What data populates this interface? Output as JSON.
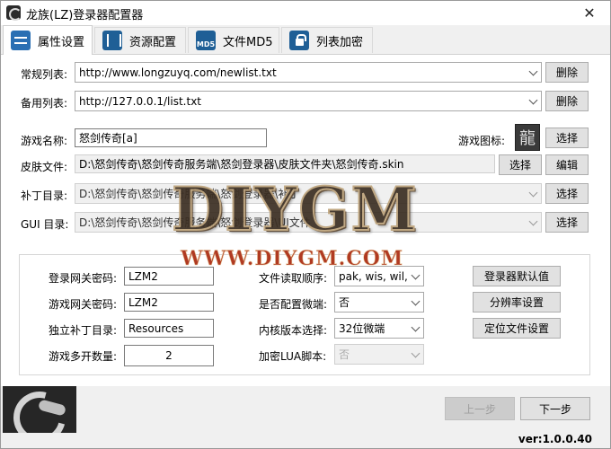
{
  "window": {
    "title": "龙族(LZ)登录器配置器",
    "close_glyph": "✕"
  },
  "tabs": [
    {
      "label": "属性设置",
      "icon": "settings-icon",
      "active": true
    },
    {
      "label": "资源配置",
      "icon": "resource-icon"
    },
    {
      "label": "文件MD5",
      "icon": "md5-icon",
      "icon_text": "MD5"
    },
    {
      "label": "列表加密",
      "icon": "lock-file-icon"
    }
  ],
  "lists": {
    "regular_label": "常规列表:",
    "regular_value": "http://www.longzuyq.com/newlist.txt",
    "backup_label": "备用列表:",
    "backup_value": "http://127.0.0.1/list.txt",
    "delete_label": "删除"
  },
  "game": {
    "name_label": "游戏名称:",
    "name_value": "怒剑传奇[a]",
    "icon_label": "游戏图标:",
    "icon_glyph": "龍",
    "choose_label": "选择"
  },
  "paths": {
    "skin_label": "皮肤文件:",
    "skin_value": "D:\\怒剑传奇\\怒剑传奇服务端\\怒剑登录器\\皮肤文件夹\\怒剑传奇.skin",
    "edit_label": "编辑",
    "patch_label": "补丁目录:",
    "patch_value": "D:\\怒剑传奇\\怒剑传奇服务端\\怒剑登录器\\补丁",
    "gui_label": "GUI 目录:",
    "gui_value": "D:\\怒剑传奇\\怒剑传奇服务端\\怒剑登录器\\UI文件"
  },
  "settings": {
    "login_gw_pwd_label": "登录网关密码:",
    "login_gw_pwd_value": "LZM2",
    "game_gw_pwd_label": "游戏网关密码:",
    "game_gw_pwd_value": "LZM2",
    "patch_dir_label": "独立补丁目录:",
    "patch_dir_value": "Resources",
    "multi_open_label": "游戏多开数量:",
    "multi_open_value": "2",
    "read_order_label": "文件读取顺序:",
    "read_order_value": "pak, wis, wil,",
    "microend_label": "是否配置微端:",
    "microend_value": "否",
    "kernel_label": "内核版本选择:",
    "kernel_value": "32位微端",
    "lua_label": "加密LUA脚本:",
    "lua_value": "否",
    "launcher_default_label": "登录器默认值",
    "resolution_label": "分辨率设置",
    "locate_file_label": "定位文件设置"
  },
  "watermark": {
    "big": "DIYGM",
    "url": "WWW.DIYGM.COM"
  },
  "footer": {
    "prev_label": "上一步",
    "next_label": "下一步",
    "version": "ver:1.0.0.40"
  }
}
